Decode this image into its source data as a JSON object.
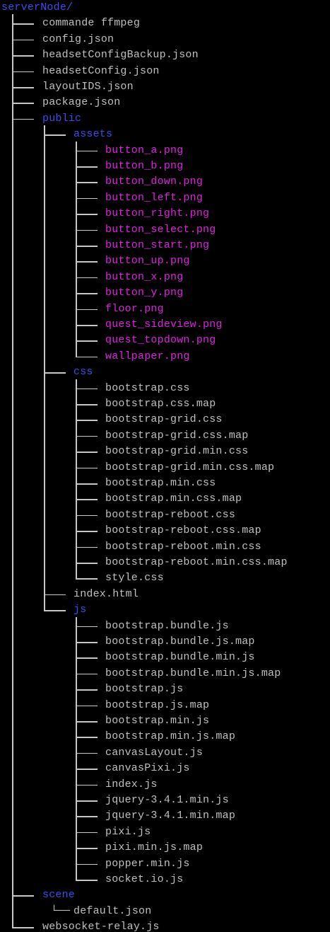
{
  "window": {
    "title": ""
  },
  "colors": {
    "background": "#000000",
    "file": "#c0c0c0",
    "directory": "#3a4ff0",
    "image": "#e020e0",
    "connector": "#c8c8c8"
  },
  "tree": [
    {
      "depth": 0,
      "label": "serverNode/",
      "kind": "root"
    },
    {
      "depth": 1,
      "label": "commande ffmpeg",
      "kind": "file"
    },
    {
      "depth": 1,
      "label": "config.json",
      "kind": "file"
    },
    {
      "depth": 1,
      "label": "headsetConfigBackup.json",
      "kind": "file"
    },
    {
      "depth": 1,
      "label": "headsetConfig.json",
      "kind": "file"
    },
    {
      "depth": 1,
      "label": "layoutIDS.json",
      "kind": "file"
    },
    {
      "depth": 1,
      "label": "package.json",
      "kind": "file"
    },
    {
      "depth": 1,
      "label": "public",
      "kind": "dir"
    },
    {
      "depth": 2,
      "label": "assets",
      "kind": "dir"
    },
    {
      "depth": 3,
      "label": "button_a.png",
      "kind": "img"
    },
    {
      "depth": 3,
      "label": "button_b.png",
      "kind": "img"
    },
    {
      "depth": 3,
      "label": "button_down.png",
      "kind": "img"
    },
    {
      "depth": 3,
      "label": "button_left.png",
      "kind": "img"
    },
    {
      "depth": 3,
      "label": "button_right.png",
      "kind": "img"
    },
    {
      "depth": 3,
      "label": "button_select.png",
      "kind": "img"
    },
    {
      "depth": 3,
      "label": "button_start.png",
      "kind": "img"
    },
    {
      "depth": 3,
      "label": "button_up.png",
      "kind": "img"
    },
    {
      "depth": 3,
      "label": "button_x.png",
      "kind": "img"
    },
    {
      "depth": 3,
      "label": "button_y.png",
      "kind": "img"
    },
    {
      "depth": 3,
      "label": "floor.png",
      "kind": "img"
    },
    {
      "depth": 3,
      "label": "quest_sideview.png",
      "kind": "img"
    },
    {
      "depth": 3,
      "label": "quest_topdown.png",
      "kind": "img"
    },
    {
      "depth": 3,
      "label": "wallpaper.png",
      "kind": "img"
    },
    {
      "depth": 2,
      "label": "css",
      "kind": "dir"
    },
    {
      "depth": 3,
      "label": "bootstrap.css",
      "kind": "file"
    },
    {
      "depth": 3,
      "label": "bootstrap.css.map",
      "kind": "file"
    },
    {
      "depth": 3,
      "label": "bootstrap-grid.css",
      "kind": "file"
    },
    {
      "depth": 3,
      "label": "bootstrap-grid.css.map",
      "kind": "file"
    },
    {
      "depth": 3,
      "label": "bootstrap-grid.min.css",
      "kind": "file"
    },
    {
      "depth": 3,
      "label": "bootstrap-grid.min.css.map",
      "kind": "file"
    },
    {
      "depth": 3,
      "label": "bootstrap.min.css",
      "kind": "file"
    },
    {
      "depth": 3,
      "label": "bootstrap.min.css.map",
      "kind": "file"
    },
    {
      "depth": 3,
      "label": "bootstrap-reboot.css",
      "kind": "file"
    },
    {
      "depth": 3,
      "label": "bootstrap-reboot.css.map",
      "kind": "file"
    },
    {
      "depth": 3,
      "label": "bootstrap-reboot.min.css",
      "kind": "file"
    },
    {
      "depth": 3,
      "label": "bootstrap-reboot.min.css.map",
      "kind": "file"
    },
    {
      "depth": 3,
      "label": "style.css",
      "kind": "file"
    },
    {
      "depth": 2,
      "label": "index.html",
      "kind": "file"
    },
    {
      "depth": 2,
      "label": "js",
      "kind": "dir"
    },
    {
      "depth": 3,
      "label": "bootstrap.bundle.js",
      "kind": "file"
    },
    {
      "depth": 3,
      "label": "bootstrap.bundle.js.map",
      "kind": "file"
    },
    {
      "depth": 3,
      "label": "bootstrap.bundle.min.js",
      "kind": "file"
    },
    {
      "depth": 3,
      "label": "bootstrap.bundle.min.js.map",
      "kind": "file"
    },
    {
      "depth": 3,
      "label": "bootstrap.js",
      "kind": "file"
    },
    {
      "depth": 3,
      "label": "bootstrap.js.map",
      "kind": "file"
    },
    {
      "depth": 3,
      "label": "bootstrap.min.js",
      "kind": "file"
    },
    {
      "depth": 3,
      "label": "bootstrap.min.js.map",
      "kind": "file"
    },
    {
      "depth": 3,
      "label": "canvasLayout.js",
      "kind": "file"
    },
    {
      "depth": 3,
      "label": "canvasPixi.js",
      "kind": "file"
    },
    {
      "depth": 3,
      "label": "index.js",
      "kind": "file"
    },
    {
      "depth": 3,
      "label": "jquery-3.4.1.min.js",
      "kind": "file"
    },
    {
      "depth": 3,
      "label": "jquery-3.4.1.min.map",
      "kind": "file"
    },
    {
      "depth": 3,
      "label": "pixi.js",
      "kind": "file"
    },
    {
      "depth": 3,
      "label": "pixi.min.js.map",
      "kind": "file"
    },
    {
      "depth": 3,
      "label": "popper.min.js",
      "kind": "file"
    },
    {
      "depth": 3,
      "label": "socket.io.js",
      "kind": "file"
    },
    {
      "depth": 1,
      "label": "scene",
      "kind": "dir"
    },
    {
      "depth": 2,
      "label": "default.json",
      "kind": "file",
      "glyph": "└──"
    },
    {
      "depth": 1,
      "label": "websocket-relay.js",
      "kind": "file"
    }
  ]
}
